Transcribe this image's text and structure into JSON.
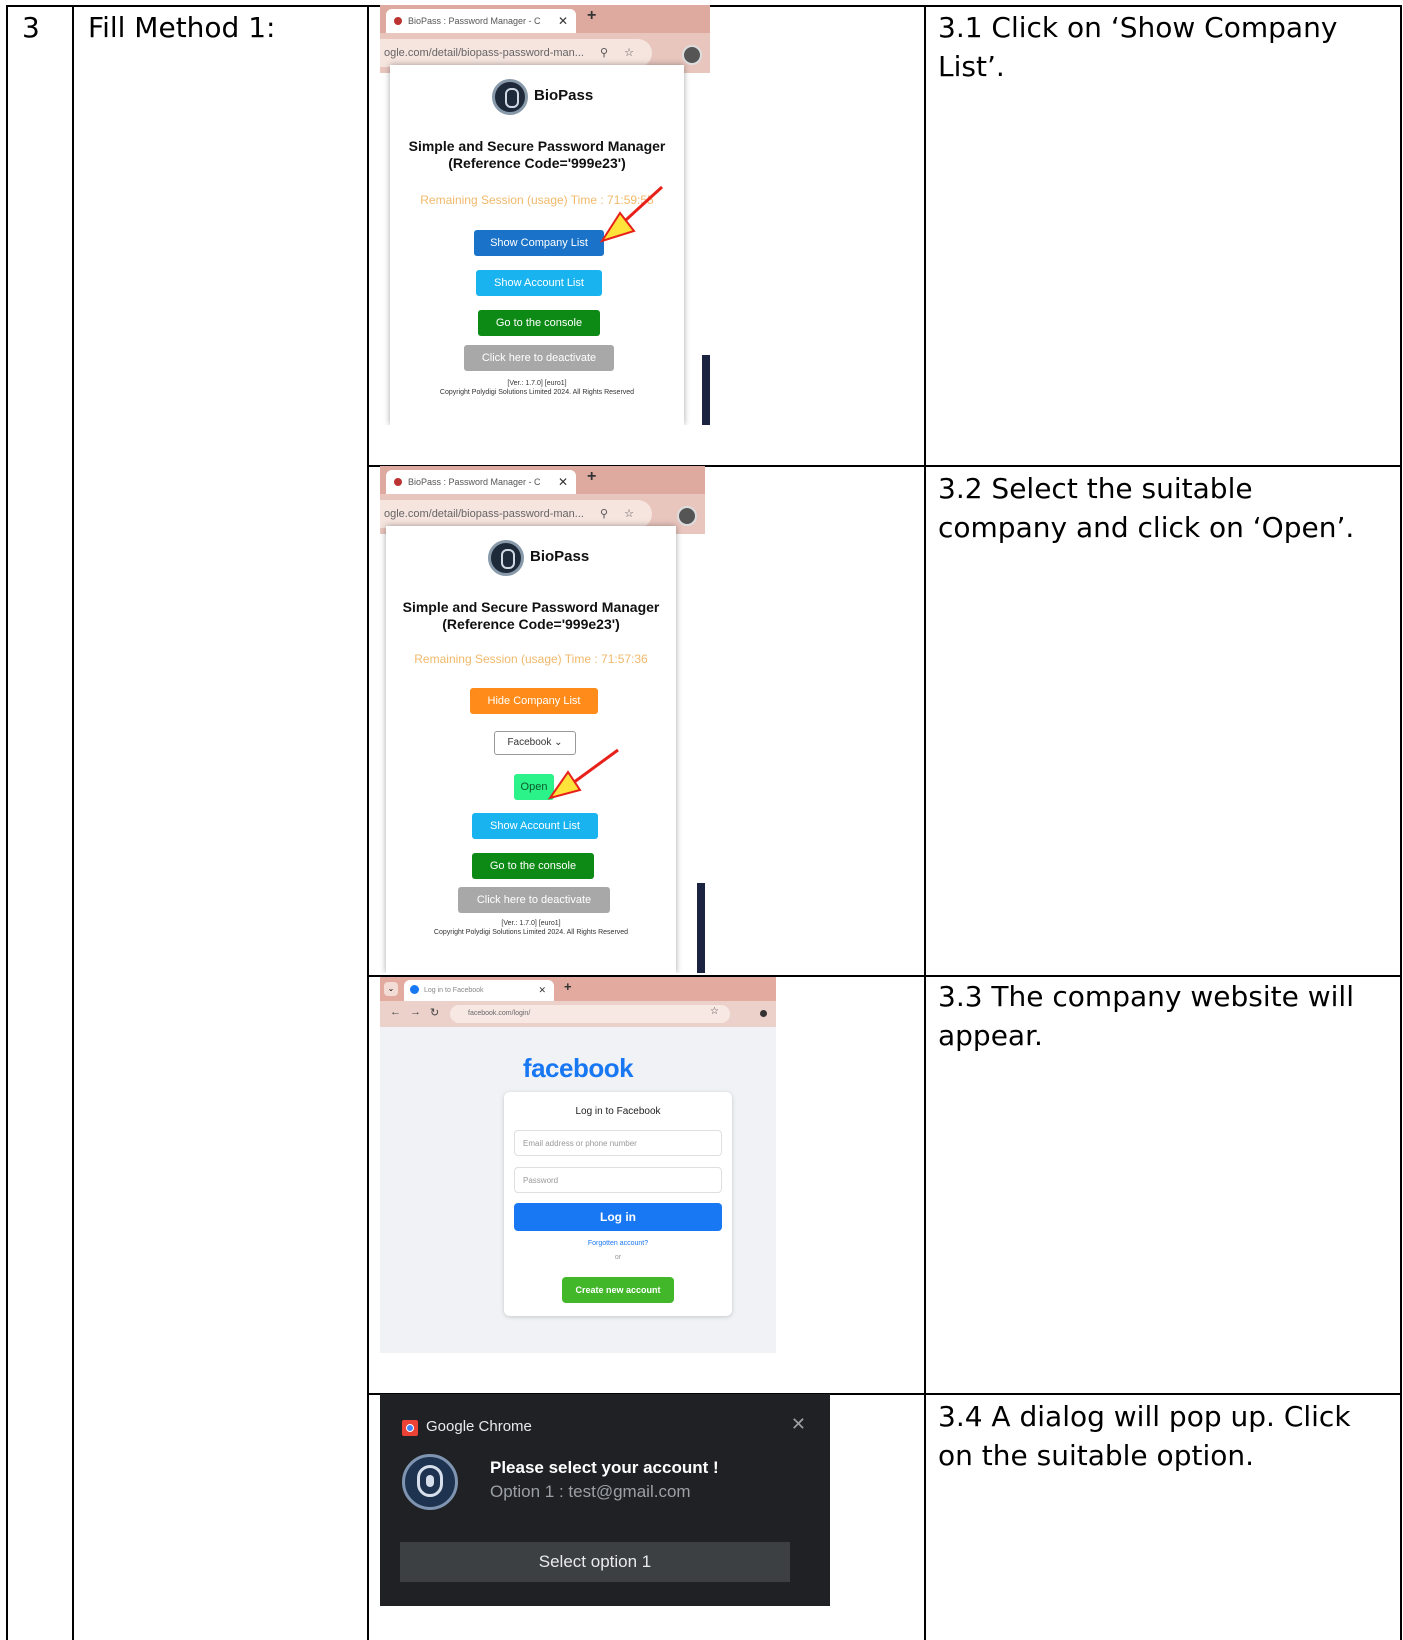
{
  "row": {
    "number": "3",
    "method": "Fill Method 1:"
  },
  "steps": [
    {
      "text": "3.1 Click on ‘Show Company List’."
    },
    {
      "text": "3.2 Select the suitable company and click on ‘Open’."
    },
    {
      "text": "3.3 The company website will appear."
    },
    {
      "text": "3.4 A dialog will pop up. Click on the suitable option."
    }
  ],
  "biopass_1": {
    "tab_title": "BioPass : Password Manager - C",
    "url": "ogle.com/detail/biopass-password-man...",
    "brand": "BioPass",
    "title_line1": "Simple and Secure Password Manager",
    "title_line2": "(Reference Code='999e23')",
    "session": "Remaining Session (usage) Time : 71:59:55",
    "btn_show_company": "Show Company List",
    "btn_show_account": "Show Account List",
    "btn_console": "Go to the console",
    "btn_deactivate": "Click here to deactivate",
    "version": "[Ver.: 1.7.0] [euro1]",
    "copyright": "Copyright Polydigi Solutions Limited 2024. All Rights Reserved"
  },
  "biopass_2": {
    "tab_title": "BioPass : Password Manager - C",
    "url": "ogle.com/detail/biopass-password-man...",
    "brand": "BioPass",
    "title_line1": "Simple and Secure Password Manager",
    "title_line2": "(Reference Code='999e23')",
    "session": "Remaining Session (usage) Time : 71:57:36",
    "btn_hide_company": "Hide Company List",
    "select_value": "Facebook",
    "btn_open": "Open",
    "btn_show_account": "Show Account List",
    "btn_console": "Go to the console",
    "btn_deactivate": "Click here to deactivate",
    "version": "[Ver.: 1.7.0] [euro1]",
    "copyright": "Copyright Polydigi Solutions Limited 2024. All Rights Reserved"
  },
  "facebook": {
    "tab_title": "Log in to Facebook",
    "url": "facebook.com/login/",
    "logo": "facebook",
    "card_title": "Log in to Facebook",
    "email_placeholder": "Email address or phone number",
    "password_placeholder": "Password",
    "login_button": "Log in",
    "forgot": "Forgotten account?",
    "or": "or",
    "create_button": "Create new account"
  },
  "chrome_notification": {
    "app": "Google Chrome",
    "title": "Please select your account !",
    "message": "Option 1 : test@gmail.com",
    "button": "Select option 1"
  },
  "colors": {
    "blue_button": "#1a73c8",
    "light_blue_button": "#19b4f0",
    "green_button": "#0d8a15",
    "grey_button": "#a8a8a8",
    "orange_button": "#ff8c1a",
    "open_button": "#2cf28a",
    "session_text": "#f0b96b",
    "annotation_arrow": "#e8201a"
  }
}
